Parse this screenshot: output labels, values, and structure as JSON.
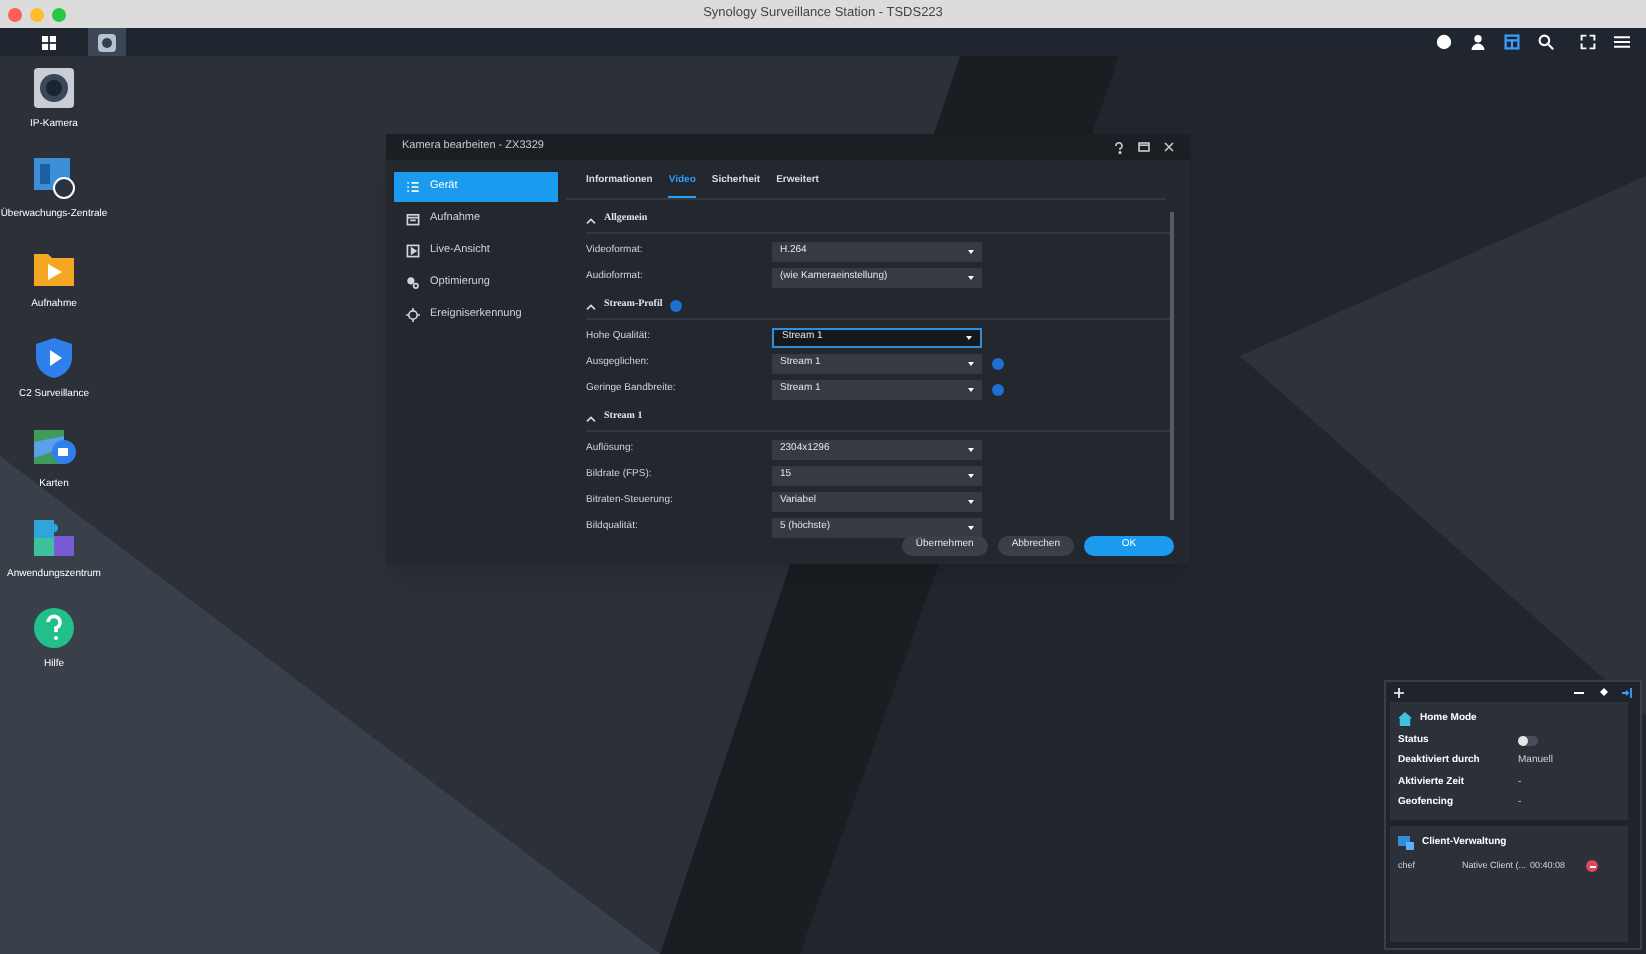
{
  "window": {
    "title": "Synology Surveillance Station - TSDS223"
  },
  "desktop_icons": [
    {
      "label": "IP-Kamera",
      "kind": "camera"
    },
    {
      "label": "Überwachungs-Zentrale",
      "kind": "monitor"
    },
    {
      "label": "Aufnahme",
      "kind": "folder"
    },
    {
      "label": "C2 Surveillance",
      "kind": "shield"
    },
    {
      "label": "Karten",
      "kind": "map"
    },
    {
      "label": "Anwendungszentrum",
      "kind": "puzzle"
    },
    {
      "label": "Hilfe",
      "kind": "help"
    }
  ],
  "dialog": {
    "title": "Kamera bearbeiten - ZX3329",
    "sidebar": [
      {
        "label": "Gerät",
        "kind": "list",
        "selected": true
      },
      {
        "label": "Aufnahme",
        "kind": "calendar",
        "selected": false
      },
      {
        "label": "Live-Ansicht",
        "kind": "play",
        "selected": false
      },
      {
        "label": "Optimierung",
        "kind": "gears",
        "selected": false
      },
      {
        "label": "Ereigniserkennung",
        "kind": "target",
        "selected": false
      }
    ],
    "tabs": [
      {
        "label": "Informationen",
        "selected": false
      },
      {
        "label": "Video",
        "selected": true
      },
      {
        "label": "Sicherheit",
        "selected": false
      },
      {
        "label": "Erweitert",
        "selected": false
      }
    ],
    "sections": [
      {
        "title": "Allgemein",
        "info": false,
        "rows": [
          {
            "label": "Videoformat:",
            "value": "H.264",
            "focused": false,
            "info": false
          },
          {
            "label": "Audioformat:",
            "value": "(wie Kameraeinstellung)",
            "focused": false,
            "info": false
          }
        ]
      },
      {
        "title": "Stream-Profil",
        "info": true,
        "rows": [
          {
            "label": "Hohe Qualität:",
            "value": "Stream 1",
            "focused": true,
            "info": false
          },
          {
            "label": "Ausgeglichen:",
            "value": "Stream 1",
            "focused": false,
            "info": true
          },
          {
            "label": "Geringe Bandbreite:",
            "value": "Stream 1",
            "focused": false,
            "info": true
          }
        ]
      },
      {
        "title": "Stream 1",
        "info": false,
        "rows": [
          {
            "label": "Auflösung:",
            "value": "2304x1296",
            "focused": false,
            "info": false
          },
          {
            "label": "Bildrate (FPS):",
            "value": "15",
            "focused": false,
            "info": false
          },
          {
            "label": "Bitraten-Steuerung:",
            "value": "Variabel",
            "focused": false,
            "info": false
          },
          {
            "label": "Bildqualität:",
            "value": "5 (höchste)",
            "focused": false,
            "info": false
          }
        ]
      }
    ],
    "buttons": [
      {
        "label": "Übernehmen",
        "kind": "secondary"
      },
      {
        "label": "Abbrechen",
        "kind": "secondary"
      },
      {
        "label": "OK",
        "kind": "primary"
      }
    ]
  },
  "widget": {
    "home_mode": {
      "title": "Home Mode",
      "rows": [
        {
          "label": "Status",
          "kind": "toggle",
          "on": false
        },
        {
          "label": "Deaktiviert durch",
          "kind": "text",
          "value": "Manuell"
        },
        {
          "label": "Aktivierte Zeit",
          "kind": "text",
          "value": "-"
        },
        {
          "label": "Geofencing",
          "kind": "text",
          "value": "-"
        }
      ]
    },
    "client": {
      "title": "Client-Verwaltung",
      "rows": [
        {
          "user": "chef",
          "client": "Native Client (...",
          "time": "00:40:08"
        }
      ]
    }
  }
}
